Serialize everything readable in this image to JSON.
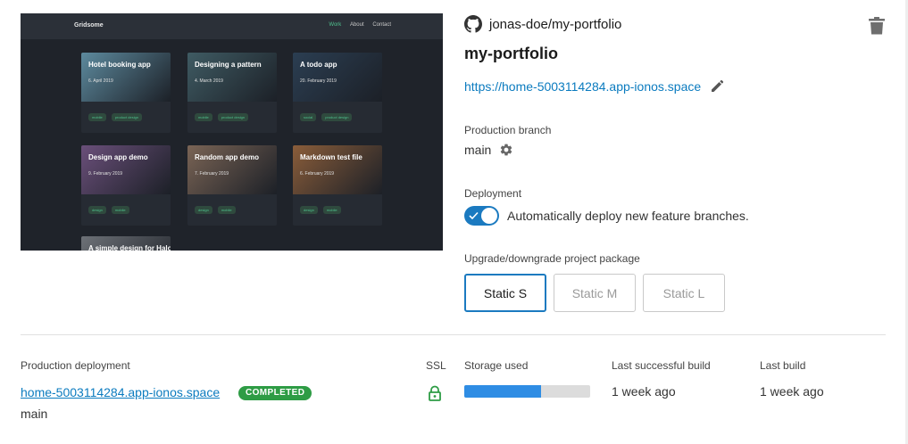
{
  "preview": {
    "nav": {
      "logo": "Gridsome",
      "links": [
        "Work",
        "About",
        "Contact"
      ],
      "active": "Work"
    },
    "cards": [
      {
        "title": "Hotel booking app",
        "date": "6. April 2019",
        "tags": [
          "mobile",
          "product design"
        ],
        "color": "#5d8a9e"
      },
      {
        "title": "Designing a pattern",
        "date": "4. March 2019",
        "tags": [
          "mobile",
          "product design"
        ],
        "color": "#3f5b63"
      },
      {
        "title": "A todo app",
        "date": "20. February 2019",
        "tags": [
          "social",
          "product design"
        ],
        "color": "#2b3e52"
      },
      {
        "title": "Design app demo",
        "date": "9. February 2019",
        "tags": [
          "design",
          "mobile"
        ],
        "color": "#6a4f7a"
      },
      {
        "title": "Random app demo",
        "date": "7. February 2019",
        "tags": [
          "design",
          "mobile"
        ],
        "color": "#7a6455"
      },
      {
        "title": "Markdown test file",
        "date": "6. February 2019",
        "tags": [
          "design",
          "mobile"
        ],
        "color": "#8a5d3a"
      },
      {
        "title": "A simple design for Halo",
        "date": "",
        "tags": [],
        "color": "#6d7177"
      }
    ]
  },
  "repo": {
    "name": "jonas-doe/my-portfolio",
    "icon": "github-icon"
  },
  "project": {
    "title": "my-portfolio",
    "url": "https://home-5003114284.app-ionos.space"
  },
  "branch": {
    "label": "Production branch",
    "value": "main"
  },
  "deployment": {
    "label": "Deployment",
    "toggle_on": true,
    "text": "Automatically deploy new feature branches."
  },
  "package": {
    "label": "Upgrade/downgrade project package",
    "options": [
      "Static S",
      "Static M",
      "Static L"
    ],
    "selected": "Static S"
  },
  "table": {
    "headers": {
      "production": "Production deployment",
      "ssl": "SSL",
      "storage": "Storage used",
      "last_success": "Last successful build",
      "last_build": "Last build"
    },
    "row": {
      "url": "home-5003114284.app-ionos.space",
      "status": "COMPLETED",
      "branch": "main",
      "storage_fraction": 0.61,
      "last_success": "1 week ago",
      "last_build": "1 week ago"
    }
  },
  "colors": {
    "accent": "#1b7ac0",
    "link": "#0b7bbf",
    "success": "#2e9c45",
    "storage": "#2f8de4"
  }
}
